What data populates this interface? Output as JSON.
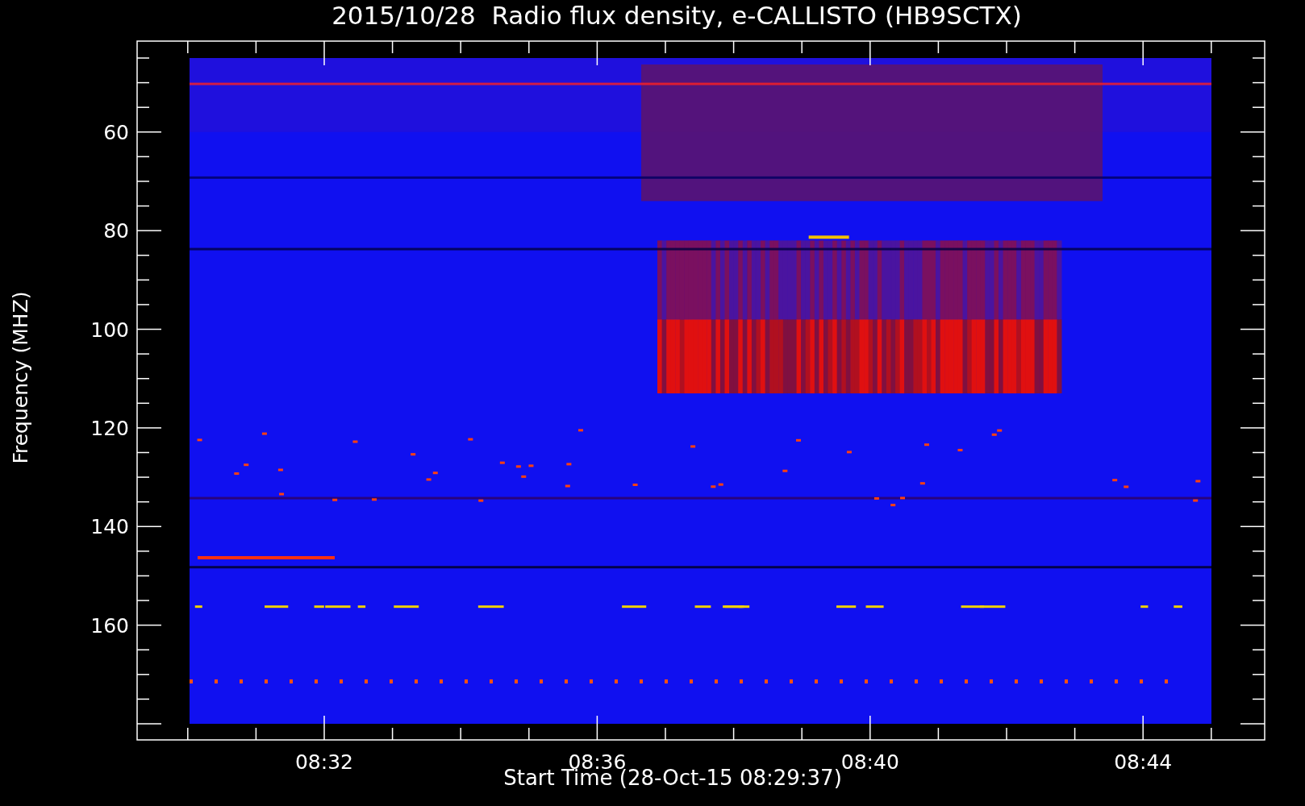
{
  "title": "2015/10/28  Radio flux density, e-CALLISTO (HB9SCTX)",
  "y_axis": {
    "label": "Frequency (MHZ)",
    "ticks": [
      "60",
      "80",
      "100",
      "120",
      "140",
      "160"
    ]
  },
  "x_axis": {
    "label": "Start Time (28-Oct-15 08:29:37)",
    "ticks": [
      "08:32",
      "08:36",
      "08:40",
      "08:44"
    ]
  }
}
